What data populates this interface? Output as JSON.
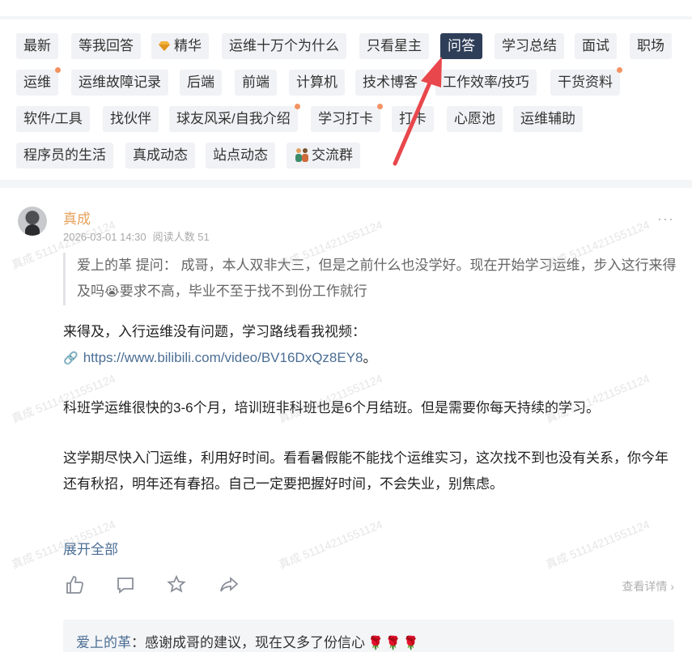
{
  "tags": {
    "t1": "最新",
    "t2": "等我回答",
    "t3": "精华",
    "t4": "运维十万个为什么",
    "t5": "只看星主",
    "t6": "问答",
    "t7": "学习总结",
    "t8": "面试",
    "t9": "职场",
    "t10": "运维",
    "t11": "运维故障记录",
    "t12": "后端",
    "t13": "前端",
    "t14": "计算机",
    "t15": "技术博客",
    "t16": "工作效率/技巧",
    "t17": "干货资料",
    "t18": "软件/工具",
    "t19": "找伙伴",
    "t20": "球友风采/自我介绍",
    "t21": "学习打卡",
    "t22": "打卡",
    "t23": "心愿池",
    "t24": "运维辅助",
    "t25": "程序员的生活",
    "t26": "真成动态",
    "t27": "站点动态",
    "t28": "交流群"
  },
  "tag_icons": {
    "t3": "gem-icon",
    "t28": "people-icon"
  },
  "post": {
    "author": "真成",
    "date": "2026-03-01 14:30",
    "readers": "阅读人数 51",
    "quote": "爱上的革  提问：  成哥，本人双非大三，但是之前什么也没学好。现在开始学习运维，步入这行来得及吗",
    "quote_end": "要求不高，毕业不至于找不到份工作就行",
    "quote_emoji": "😭",
    "p1_text": "来得及，入行运维没有问题，学习路线看我视频：",
    "p1_link": "https://www.bilibili.com/video/BV16DxQz8EY8",
    "p1_end": "。",
    "p2": "科班学运维很快的3-6个月，培训班非科班也是6个月结班。但是需要你每天持续的学习。",
    "p3": "这学期尽快入门运维，利用好时间。看看暑假能不能找个运维实习，这次找不到也没有关系，你今年还有秋招，明年还有春招。自己一定要把握好时间，不会失业，别焦虑。",
    "expand": "展开全部",
    "detail": "查看详情",
    "more": "···"
  },
  "comment": {
    "name": "爱上的革",
    "sep": "：",
    "text": "感谢成哥的建议，现在又多了份信心",
    "roses": "🌹🌹🌹"
  },
  "watermark": "真成 51114211551124",
  "colors": {
    "active_tag_bg": "#2f3e58",
    "author": "#e6a15c",
    "link": "#4b6e94",
    "dot": "#f39361",
    "arrow": "#e8474c"
  }
}
